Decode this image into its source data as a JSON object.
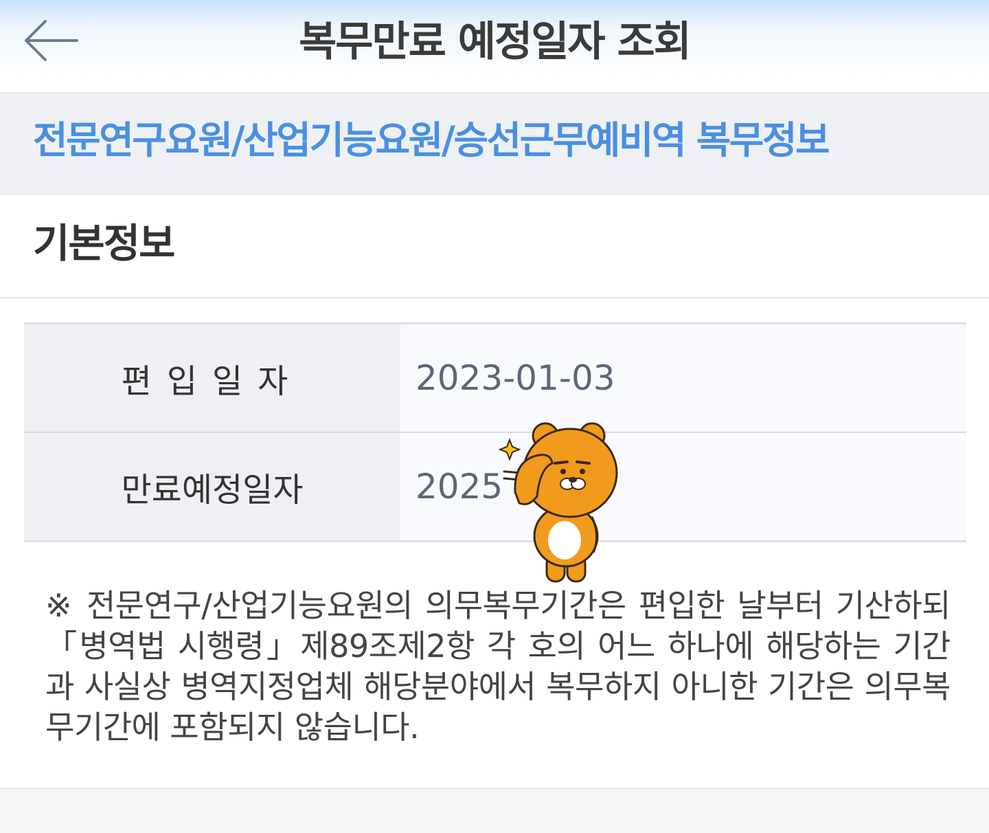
{
  "header": {
    "title": "복무만료 예정일자 조회",
    "back_icon": "arrow-left-icon"
  },
  "banner": {
    "title": "전문연구요원/산업기능요원/승선근무예비역 복무정보"
  },
  "section": {
    "title": "기본정보"
  },
  "info_rows": [
    {
      "label": "편입일자",
      "value": "2023-01-03"
    },
    {
      "label": "만료예정일자",
      "value": "2025"
    }
  ],
  "notice": "※ 전문연구/산업기능요원의 의무복무기간은 편입한 날부터 기산하되「병역법 시행령」제89조제2항 각 호의 어느 하나에 해당하는 기간과 사실상 병역지정업체 해당분야에서 복무하지 아니한 기간은 의무복무기간에 포함되지 않습니다.",
  "sticker": {
    "icon": "bear-character-sticker",
    "colors": {
      "fur": "#f29a1c",
      "belly": "#ffffff",
      "outline": "#3a2a1a",
      "sparkle": "#f5c518"
    }
  },
  "colors": {
    "accent": "#4a90e2",
    "title_text": "#3b3b3b",
    "label_background": "#eef0f4",
    "value_text": "#5c6677"
  }
}
